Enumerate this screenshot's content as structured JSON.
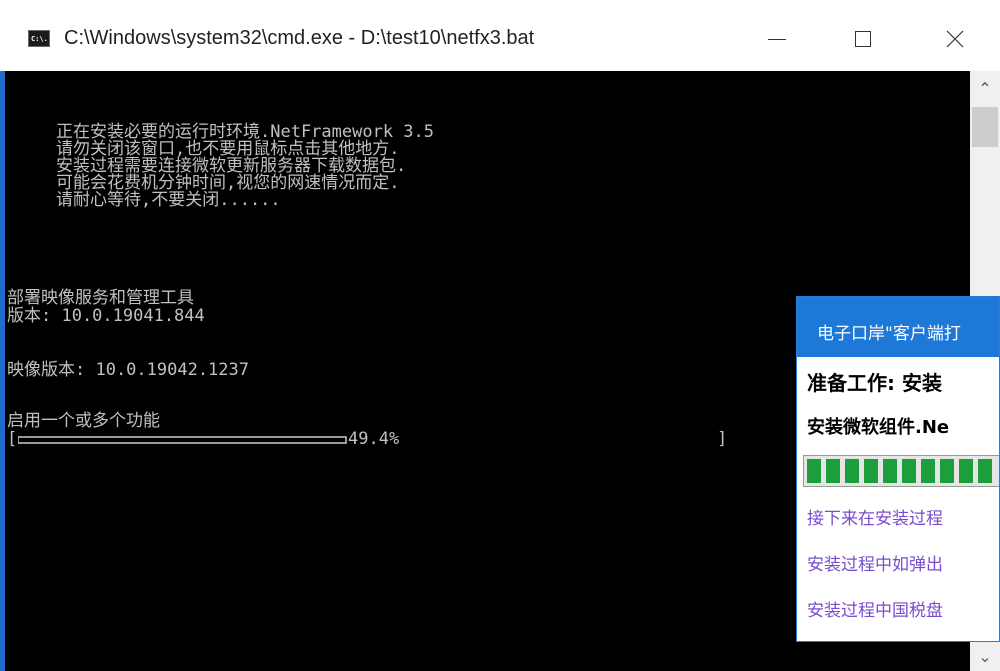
{
  "window": {
    "title": "C:\\Windows\\system32\\cmd.exe - D:\\test10\\netfx3.bat",
    "icon_text": "C:\\."
  },
  "console": {
    "intro_lines": [
      "正在安装必要的运行时环境.NetFramework 3.5",
      "请勿关闭该窗口,也不要用鼠标点击其他地方.",
      "安装过程需要连接微软更新服务器下载数据包.",
      "可能会花费机分钟时间,视您的网速情况而定.",
      "请耐心等待,不要关闭......"
    ],
    "tool_name": "部署映像服务和管理工具",
    "tool_version": "版本: 10.0.19041.844",
    "image_version": "映像版本: 10.0.19042.1237",
    "enable_features": "启用一个或多个功能",
    "progress_open": "[",
    "progress_text": "49.4%",
    "progress_close": "]",
    "progress_fraction": 0.494
  },
  "popup": {
    "title": "电子口岸\"客户端打",
    "heading": "准备工作: 安装",
    "subheading": "安装微软组件.Ne",
    "progress_segments": 10,
    "links": [
      "接下来在安装过程",
      "安装过程中如弹出",
      "安装过程中国税盘"
    ],
    "link_color": "#7a4ccf"
  }
}
